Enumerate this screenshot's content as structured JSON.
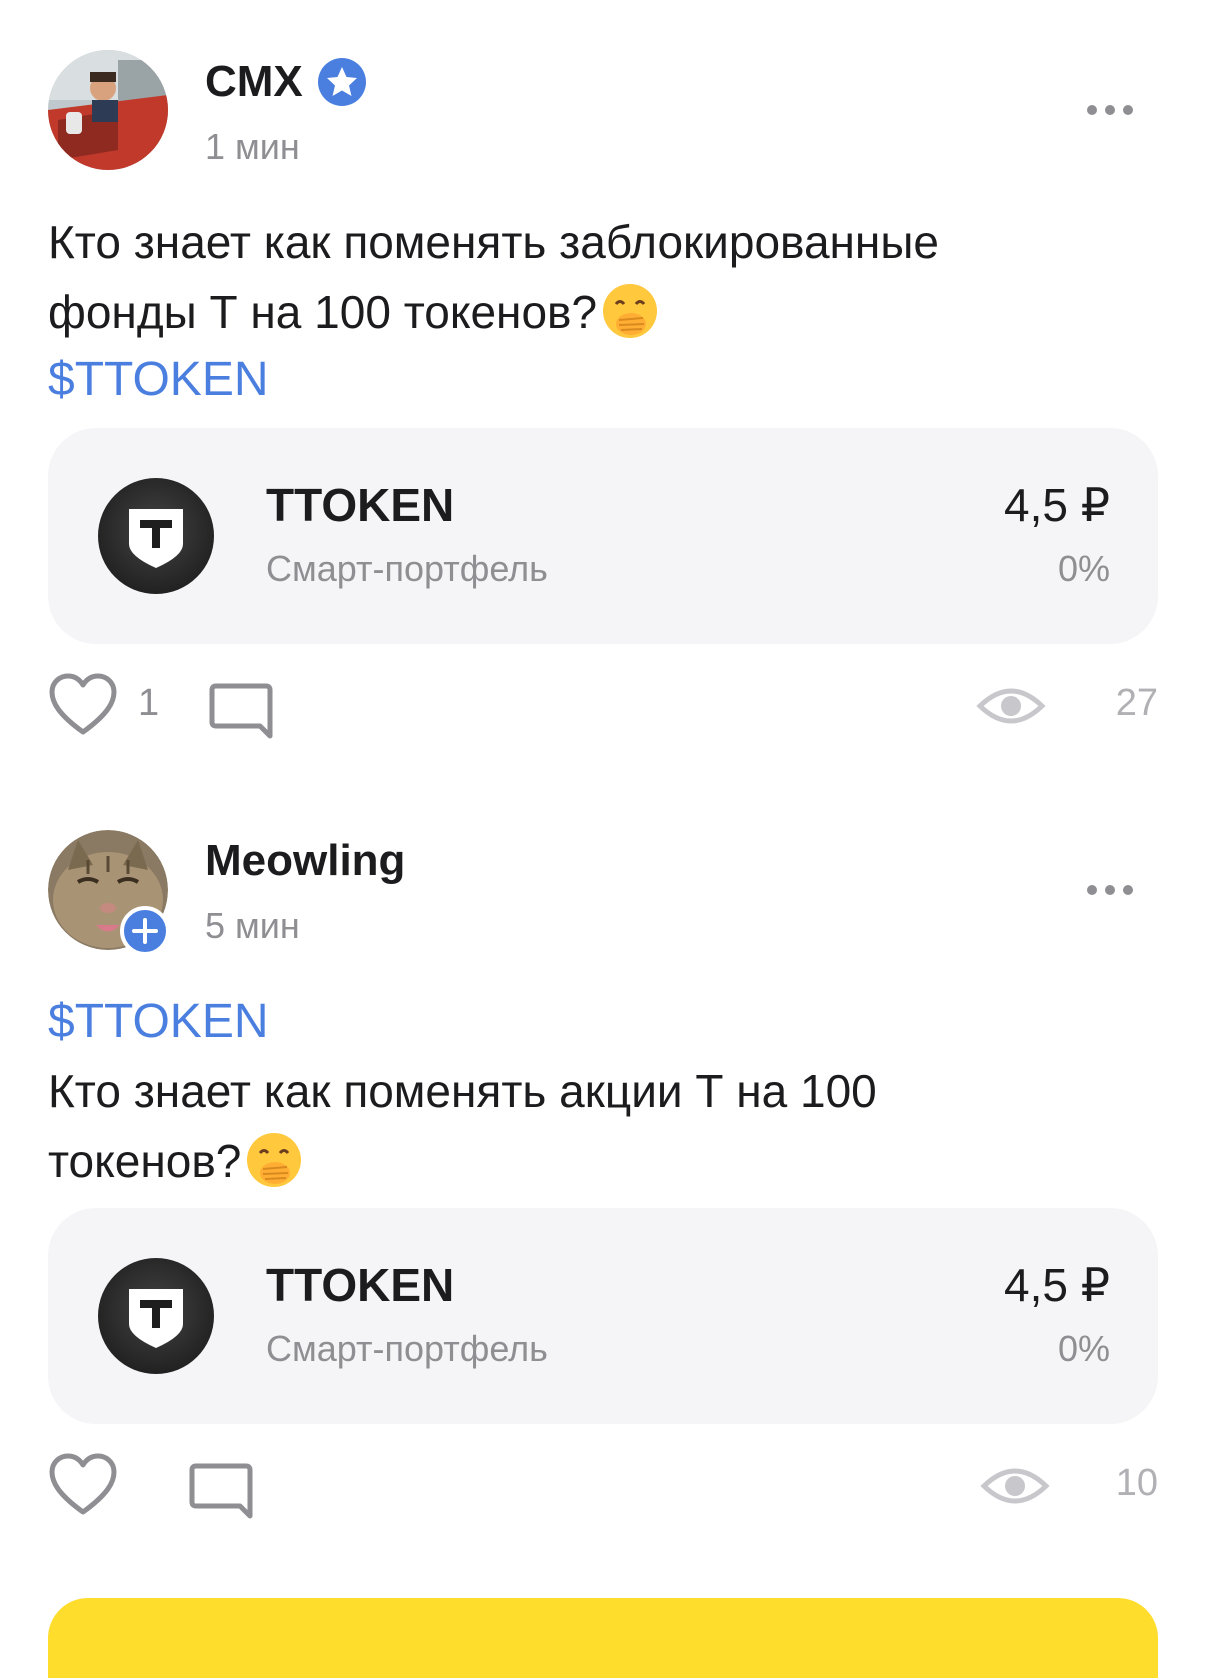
{
  "posts": [
    {
      "author": "CMX",
      "verified": true,
      "time": "1 мин",
      "text_lines": [
        "Кто знает как поменять заблокированные",
        "фонды Т на 100 токенов?"
      ],
      "ticker": "$TTOKEN",
      "card": {
        "title": "TTOKEN",
        "subtitle": "Смарт-портфель",
        "price": "4,5 ₽",
        "change": "0%"
      },
      "likes": "1",
      "views": "27"
    },
    {
      "author": "Meowling",
      "verified": false,
      "time": "5 мин",
      "ticker": "$TTOKEN",
      "text_lines": [
        "Кто знает как поменять акции Т на 100",
        "токенов?"
      ],
      "card": {
        "title": "TTOKEN",
        "subtitle": "Смарт-портфель",
        "price": "4,5 ₽",
        "change": "0%"
      },
      "likes": "",
      "views": "10"
    }
  ],
  "colors": {
    "accent": "#4a7fe0",
    "card_bg": "#f5f5f7",
    "cta": "#ffdd2d",
    "muted": "#8e8e93"
  }
}
